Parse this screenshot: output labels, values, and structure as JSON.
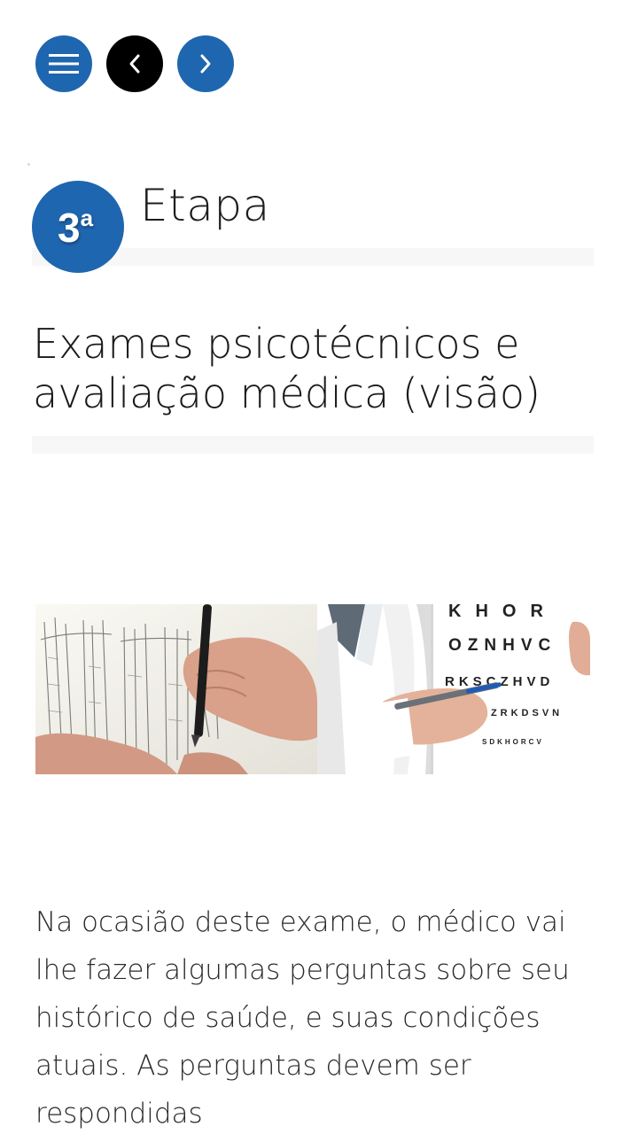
{
  "nav": {
    "menu_icon": "hamburger-menu-icon",
    "prev_icon": "chevron-left-icon",
    "next_icon": "chevron-right-icon",
    "colors": {
      "primary": "#1f66b0",
      "prev_bg": "#000000"
    }
  },
  "step": {
    "number": "3",
    "ordinal": "a",
    "label": "Etapa"
  },
  "title": "Exames psicotécnicos e avaliação médica (visão)",
  "image": {
    "chart_lines": [
      "K H O R",
      "O Z N H V C",
      "R K S C Z H V D",
      "C Z R K D S V N",
      "S D K H O R C V"
    ]
  },
  "body": "Na ocasião deste exame, o médico vai lhe fazer algumas perguntas sobre seu histórico de saúde, e suas condições atuais. As perguntas devem ser respondidas"
}
